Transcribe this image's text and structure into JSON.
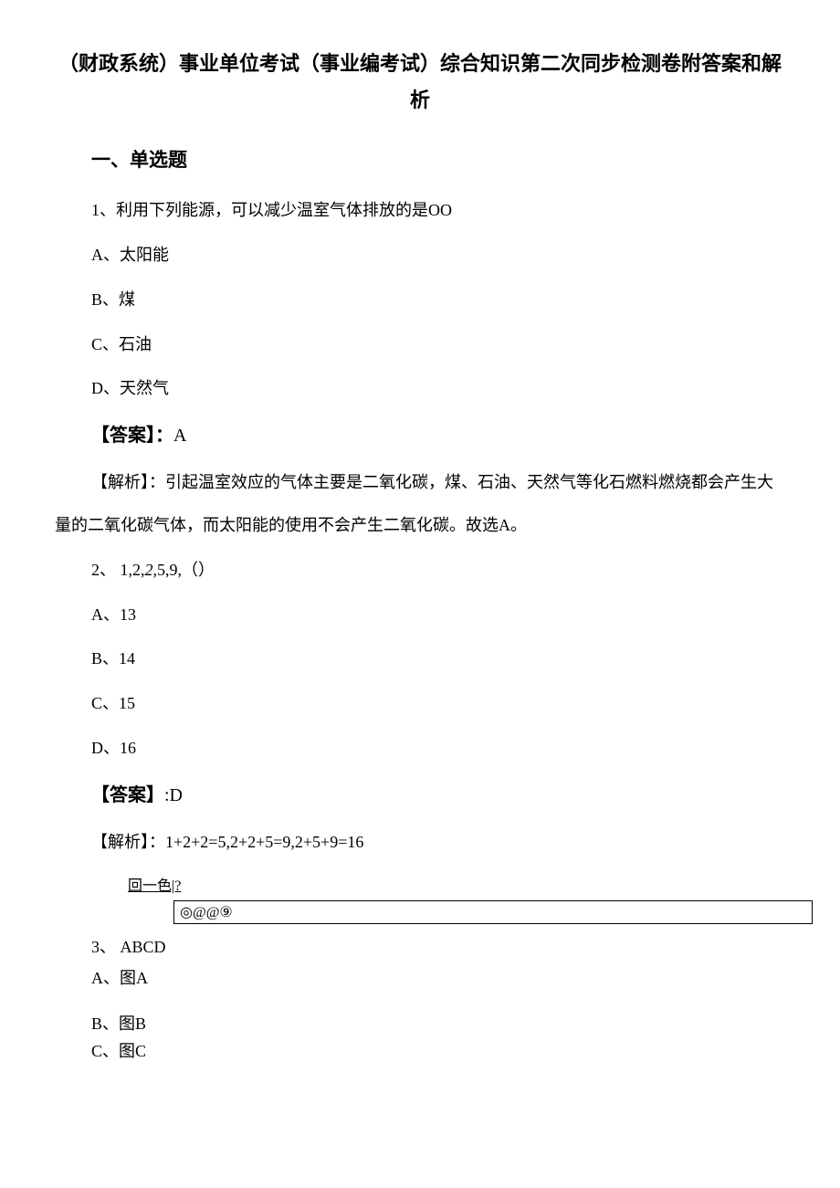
{
  "title": "（财政系统）事业单位考试（事业编考试）综合知识第二次同步检测卷附答案和解析",
  "section1": {
    "heading": "一、单选题",
    "q1": {
      "stem": "1、利用下列能源，可以减少温室气体排放的是OO",
      "optA": "A、太阳能",
      "optB": "B、煤",
      "optC": "C、石油",
      "optD": "D、天然气",
      "answerLabel": "【答案】：",
      "answerValue": "A",
      "explanation": "【解析】：引起温室效应的气体主要是二氧化碳，煤、石油、天然气等化石燃料燃烧都会产生大量的二氧化碳气体，而太阳能的使用不会产生二氧化碳。故选A。"
    },
    "q2": {
      "stem_prefix": "2、 1,2,",
      "stem_italic": "2,",
      "stem_suffix": "5,9,（）",
      "optA": "A、13",
      "optB": "B、14",
      "optC": "C、15",
      "optD": "D、16",
      "answerLabel": "【答案】",
      "answerValue": ":D",
      "explanation": "【解析】：1+2+2=5,2+2+5=9,2+5+9=16"
    },
    "q3": {
      "figCaption": "回一色|?",
      "figBox": "◎@@⑨",
      "stem": "3、 ABCD",
      "optA": "A、图A",
      "optB": "B、图B",
      "optC": "C、图C"
    }
  }
}
